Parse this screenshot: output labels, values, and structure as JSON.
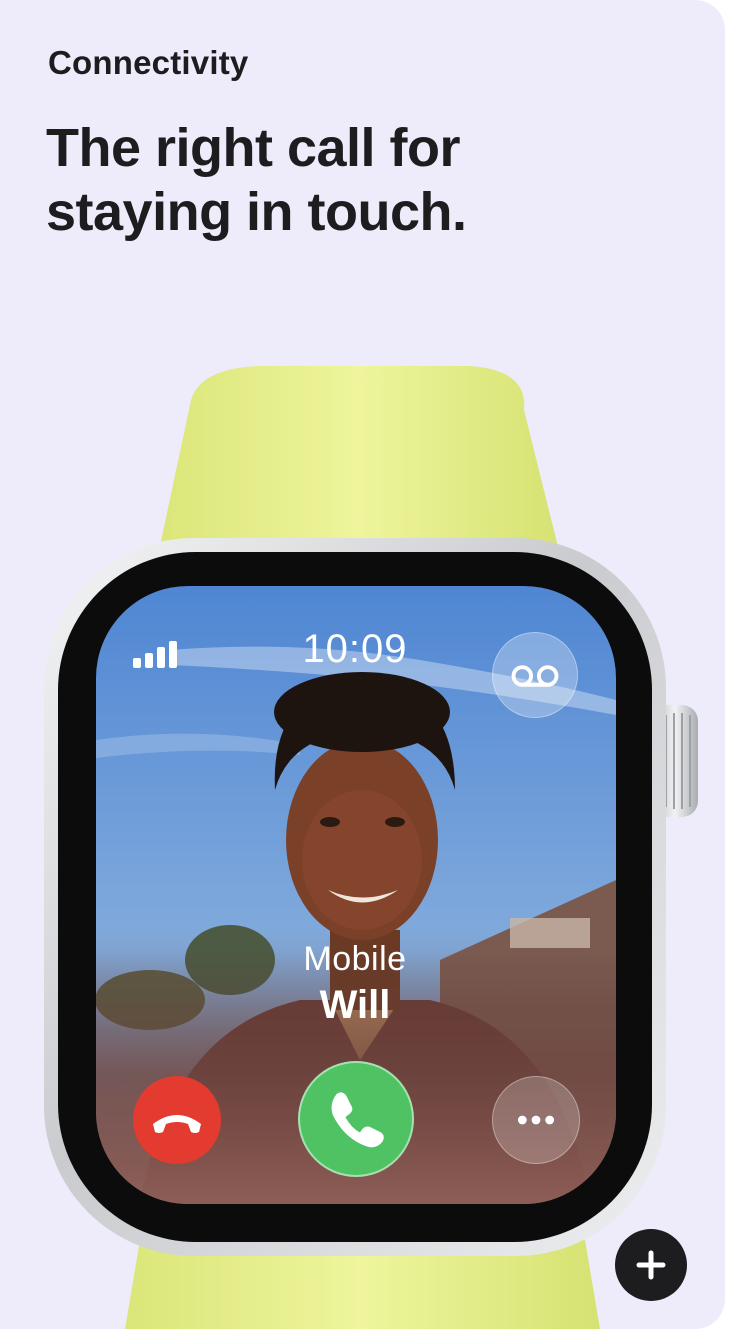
{
  "section": {
    "eyebrow": "Connectivity",
    "headline_line1": "The right call for",
    "headline_line2": "staying in touch."
  },
  "watch": {
    "time": "10:09",
    "caller_label": "Mobile",
    "caller_name": "Will",
    "band_color": "#e7f08a",
    "case_color": "#d7d9dc",
    "icons": {
      "signal": "cellular-signal-icon",
      "voicemail": "voicemail-icon",
      "decline": "phone-decline-icon",
      "accept": "phone-accept-icon",
      "more": "more-options-icon"
    }
  },
  "colors": {
    "background": "#eeecfb",
    "text": "#1d1d1f",
    "decline": "#e33b2f",
    "accept": "#4fc264"
  },
  "expand_button": {
    "icon": "plus-icon"
  }
}
